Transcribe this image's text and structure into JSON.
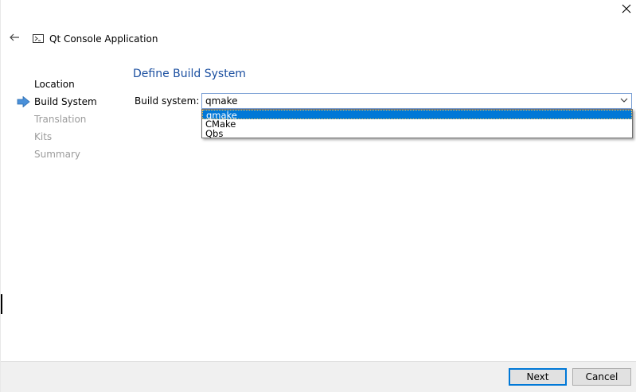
{
  "window": {
    "title": "Qt Console Application",
    "close_icon": "close-icon",
    "back_icon": "back-arrow-icon",
    "title_icon": "console-icon"
  },
  "steps": [
    {
      "label": "Location",
      "state": "done"
    },
    {
      "label": "Build System",
      "state": "current"
    },
    {
      "label": "Translation",
      "state": "pending"
    },
    {
      "label": "Kits",
      "state": "pending"
    },
    {
      "label": "Summary",
      "state": "pending"
    }
  ],
  "page": {
    "title": "Define Build System",
    "field_label": "Build system:"
  },
  "combo": {
    "value": "qmake",
    "options": [
      "qmake",
      "CMake",
      "Qbs"
    ],
    "selected_index": 0
  },
  "buttons": {
    "next": "Next",
    "cancel": "Cancel"
  },
  "colors": {
    "accent": "#0078d7",
    "page_title": "#1b4fa0",
    "pending_step": "#9b9b9b",
    "step_arrow": "#4a90d9"
  }
}
